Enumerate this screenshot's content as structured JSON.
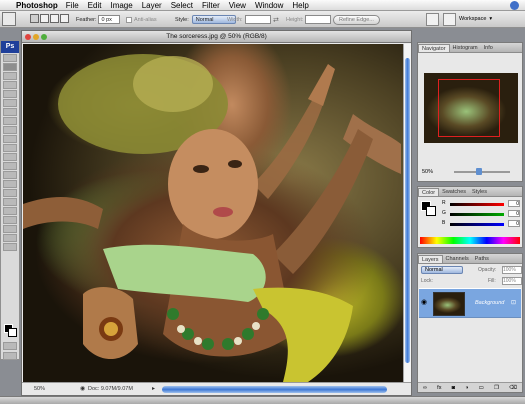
{
  "menubar": {
    "app_name": "Photoshop",
    "items": [
      "File",
      "Edit",
      "Image",
      "Layer",
      "Select",
      "Filter",
      "View",
      "Window",
      "Help"
    ]
  },
  "options_bar": {
    "feather_label": "Feather:",
    "feather_value": "0 px",
    "antialias_label": "Anti-alias",
    "style_label": "Style:",
    "style_value": "Normal",
    "width_label": "Width:",
    "height_label": "Height:",
    "refine_edge_label": "Refine Edge...",
    "workspace_label": "Workspace"
  },
  "toolbox": {
    "logo": "Ps"
  },
  "document": {
    "title": "The sorceress.jpg @ 50% (RGB/8)",
    "zoom": "50%",
    "doc_info": "Doc: 9.07M/9.07M"
  },
  "navigator": {
    "tabs": [
      "Navigator",
      "Histogram",
      "Info"
    ],
    "zoom": "50%"
  },
  "color": {
    "tabs": [
      "Color",
      "Swatches",
      "Styles"
    ],
    "r_label": "R",
    "g_label": "G",
    "b_label": "B",
    "r_value": "0",
    "g_value": "0",
    "b_value": "0"
  },
  "layers": {
    "tabs": [
      "Layers",
      "Channels",
      "Paths"
    ],
    "blend_mode": "Normal",
    "opacity_label": "Opacity:",
    "opacity_value": "100%",
    "lock_label": "Lock:",
    "fill_label": "Fill:",
    "fill_value": "100%",
    "layer_name": "Background"
  },
  "colors": {
    "accent_blue": "#3d78d6",
    "ps_logo_bg": "#1f3f9a",
    "selected_layer": "#7aa6e0"
  }
}
